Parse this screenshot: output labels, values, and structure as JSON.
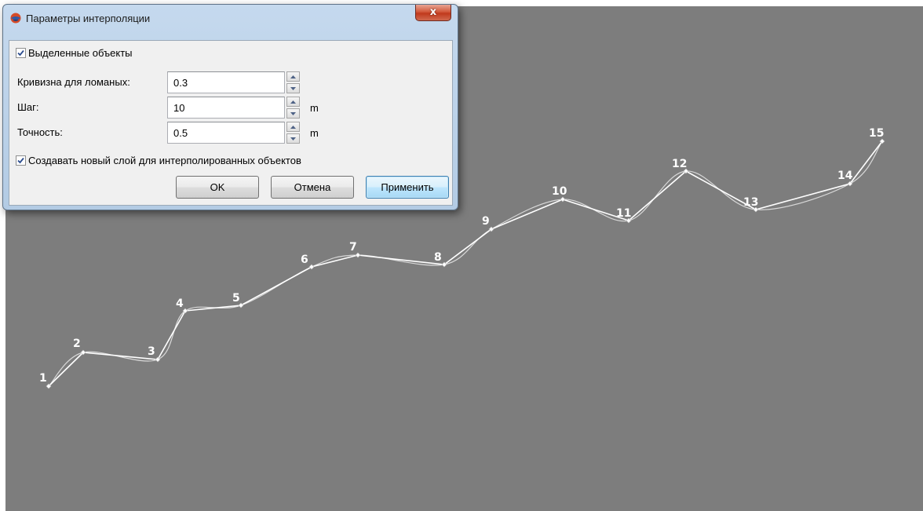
{
  "dialog": {
    "title": "Параметры интерполяции",
    "close_label": "x",
    "selected_objects": {
      "label": "Выделенные объекты",
      "checked": true
    },
    "curvature": {
      "label": "Кривизна для ломаных:",
      "value": "0.3"
    },
    "step": {
      "label": "Шаг:",
      "value": "10",
      "unit": "m"
    },
    "precision": {
      "label": "Точность:",
      "value": "0.5",
      "unit": "m"
    },
    "new_layer": {
      "label": "Создавать новый слой для интерполированных объектов",
      "checked": true
    },
    "buttons": {
      "ok": "OK",
      "cancel": "Отмена",
      "apply": "Применить"
    }
  },
  "polyline": {
    "vertex_labels": [
      "1",
      "2",
      "3",
      "4",
      "5",
      "6",
      "7",
      "8",
      "9",
      "10",
      "11",
      "12",
      "13",
      "14",
      "15"
    ],
    "line_color": "#ffffff",
    "background_color": "#7d7d7d"
  }
}
